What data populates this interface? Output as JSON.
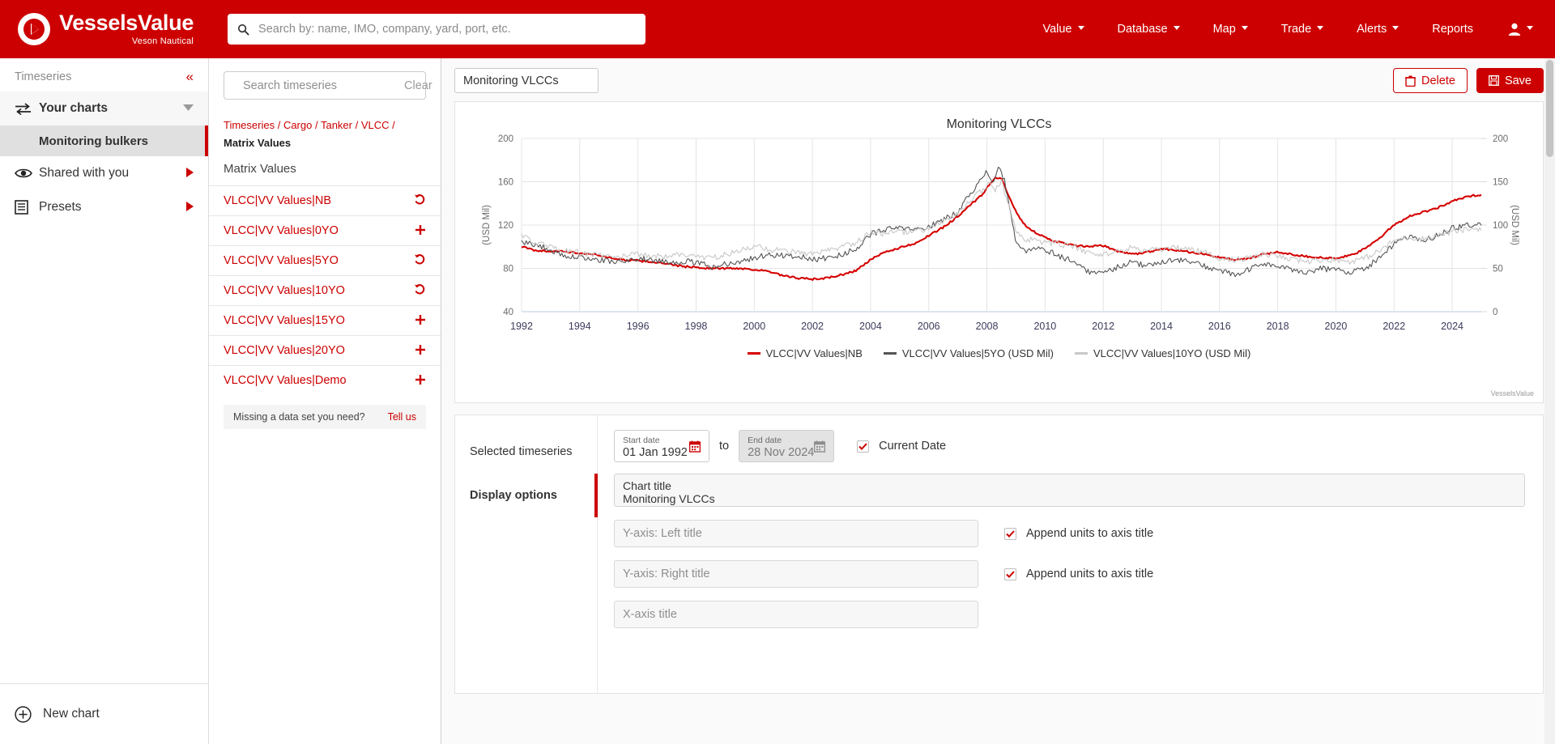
{
  "topbar": {
    "brand_name": "VesselsValue",
    "brand_sub": "Veson Nautical",
    "search_placeholder": "Search by: name, IMO, company, yard, port, etc.",
    "nav": [
      {
        "label": "Value",
        "caret": true
      },
      {
        "label": "Database",
        "caret": true
      },
      {
        "label": "Map",
        "caret": true
      },
      {
        "label": "Trade",
        "caret": true
      },
      {
        "label": "Alerts",
        "caret": true
      },
      {
        "label": "Reports",
        "caret": false
      }
    ],
    "user_icon": "user-icon"
  },
  "leftnav": {
    "title": "Timeseries",
    "collapse_icon": "collapse-left-icon",
    "your_charts": {
      "label": "Your charts",
      "icon": "transfer-icon"
    },
    "your_charts_children": [
      {
        "label": "Monitoring bulkers",
        "selected": true
      }
    ],
    "shared": {
      "label": "Shared with you",
      "icon": "eye-icon"
    },
    "presets": {
      "label": "Presets",
      "icon": "book-icon"
    },
    "new_chart": {
      "label": "New chart",
      "icon": "plus-circle-icon"
    }
  },
  "timeseries_panel": {
    "search_placeholder": "Search timeseries",
    "clear_label": "Clear",
    "breadcrumb": [
      "Timeseries",
      "Cargo",
      "Tanker",
      "VLCC"
    ],
    "breadcrumb_current": "Matrix Values",
    "group_label": "Matrix Values",
    "items": [
      {
        "label": "VLCC|VV Values|NB",
        "action": "undo"
      },
      {
        "label": "VLCC|VV Values|0YO",
        "action": "add"
      },
      {
        "label": "VLCC|VV Values|5YO",
        "action": "undo"
      },
      {
        "label": "VLCC|VV Values|10YO",
        "action": "undo"
      },
      {
        "label": "VLCC|VV Values|15YO",
        "action": "add"
      },
      {
        "label": "VLCC|VV Values|20YO",
        "action": "add"
      },
      {
        "label": "VLCC|VV Values|Demo",
        "action": "add"
      }
    ],
    "missing_text": "Missing a data set you need?",
    "missing_link": "Tell us"
  },
  "content_header": {
    "chart_name_value": "Monitoring VLCCs",
    "delete_label": "Delete",
    "save_label": "Save",
    "delete_icon": "trash-icon",
    "save_icon": "floppy-disk-icon"
  },
  "chart_data": {
    "type": "line",
    "title": "Monitoring VLCCs",
    "xlabel": "",
    "ylabel": "(USD Mil)",
    "ylabel_right": "(USD Mil)",
    "grid": true,
    "legend_position": "bottom",
    "xlim": [
      1992,
      2025
    ],
    "x_ticks": [
      1992,
      1994,
      1996,
      1998,
      2000,
      2002,
      2004,
      2006,
      2008,
      2010,
      2012,
      2014,
      2016,
      2018,
      2020,
      2022,
      2024
    ],
    "ylim_left": [
      40,
      200
    ],
    "y_ticks_left": [
      40,
      80,
      120,
      160,
      200
    ],
    "ylim_right": [
      0,
      200
    ],
    "y_ticks_right": [
      0,
      50,
      100,
      150,
      200
    ],
    "watermark": "VesselsValue",
    "series": [
      {
        "name": "VLCC|VV Values|NB",
        "color": "#d50000",
        "axis": "left",
        "x": [
          1992.0,
          1992.4,
          1992.8,
          1993.2,
          1993.6,
          1994.0,
          1994.5,
          1995.0,
          1995.5,
          1996.0,
          1996.5,
          1997.0,
          1997.5,
          1998.0,
          1998.5,
          1999.0,
          1999.5,
          2000.0,
          2000.5,
          2001.0,
          2001.5,
          2002.0,
          2002.5,
          2003.0,
          2003.5,
          2004.0,
          2004.5,
          2005.0,
          2005.5,
          2006.0,
          2006.5,
          2007.0,
          2007.3,
          2007.6,
          2007.9,
          2008.1,
          2008.3,
          2008.5,
          2008.7,
          2009.0,
          2009.3,
          2009.7,
          2010.0,
          2010.5,
          2011.0,
          2011.5,
          2012.0,
          2012.5,
          2013.0,
          2013.5,
          2014.0,
          2014.5,
          2015.0,
          2015.5,
          2016.0,
          2016.5,
          2017.0,
          2017.5,
          2018.0,
          2018.5,
          2019.0,
          2019.5,
          2020.0,
          2020.5,
          2021.0,
          2021.5,
          2022.0,
          2022.5,
          2023.0,
          2023.5,
          2024.0,
          2024.5,
          2024.9
        ],
        "y": [
          100,
          97,
          96,
          96,
          95,
          94,
          93,
          90,
          88,
          87,
          86,
          84,
          82,
          81,
          80,
          80,
          80,
          79,
          77,
          73,
          71,
          70,
          71,
          74,
          78,
          88,
          95,
          99,
          103,
          110,
          118,
          128,
          136,
          142,
          150,
          158,
          164,
          163,
          150,
          132,
          120,
          113,
          108,
          104,
          101,
          100,
          101,
          96,
          93,
          95,
          98,
          97,
          95,
          93,
          90,
          88,
          89,
          93,
          95,
          93,
          91,
          90,
          89,
          92,
          98,
          108,
          120,
          128,
          132,
          136,
          142,
          146,
          148
        ]
      },
      {
        "name": "VLCC|VV Values|5YO (USD Mil)",
        "color": "#555555",
        "axis": "right",
        "x": [
          1992.0,
          1992.5,
          1993.0,
          1993.5,
          1994.0,
          1994.5,
          1995.0,
          1995.5,
          1996.0,
          1996.5,
          1997.0,
          1997.5,
          1998.0,
          1998.5,
          1999.0,
          1999.5,
          2000.0,
          2000.5,
          2001.0,
          2001.5,
          2002.0,
          2002.5,
          2003.0,
          2003.5,
          2004.0,
          2004.5,
          2005.0,
          2005.5,
          2006.0,
          2006.5,
          2007.0,
          2007.3,
          2007.6,
          2007.8,
          2008.0,
          2008.2,
          2008.4,
          2008.6,
          2008.8,
          2009.0,
          2009.3,
          2009.7,
          2010.0,
          2010.5,
          2011.0,
          2011.5,
          2012.0,
          2012.5,
          2013.0,
          2013.5,
          2014.0,
          2014.5,
          2015.0,
          2015.5,
          2016.0,
          2016.5,
          2017.0,
          2017.5,
          2018.0,
          2018.5,
          2019.0,
          2019.5,
          2020.0,
          2020.5,
          2021.0,
          2021.5,
          2022.0,
          2022.5,
          2023.0,
          2023.5,
          2024.0,
          2024.5,
          2024.9
        ],
        "y": [
          81,
          77,
          72,
          62,
          63,
          61,
          58,
          57,
          62,
          60,
          57,
          58,
          57,
          52,
          55,
          58,
          62,
          66,
          65,
          64,
          60,
          62,
          66,
          72,
          90,
          94,
          97,
          94,
          98,
          106,
          115,
          132,
          143,
          152,
          162,
          148,
          168,
          152,
          115,
          78,
          70,
          74,
          72,
          64,
          58,
          46,
          44,
          52,
          58,
          52,
          58,
          60,
          58,
          52,
          48,
          42,
          48,
          56,
          52,
          48,
          46,
          50,
          48,
          46,
          50,
          62,
          78,
          86,
          82,
          88,
          96,
          100,
          101
        ]
      },
      {
        "name": "VLCC|VV Values|10YO (USD Mil)",
        "color": "#c8c8c8",
        "axis": "right",
        "x": [
          1992.0,
          1992.5,
          1993.0,
          1993.5,
          1994.0,
          1994.5,
          1995.0,
          1995.5,
          1996.0,
          1996.5,
          1997.0,
          1997.5,
          1998.0,
          1998.5,
          1999.0,
          1999.5,
          2000.0,
          2000.5,
          2001.0,
          2001.5,
          2002.0,
          2002.5,
          2003.0,
          2003.5,
          2004.0,
          2004.5,
          2005.0,
          2005.5,
          2006.0,
          2006.5,
          2007.0,
          2007.3,
          2007.6,
          2007.9,
          2008.1,
          2008.3,
          2008.5,
          2008.7,
          2009.0,
          2009.3,
          2009.7,
          2010.0,
          2010.5,
          2011.0,
          2011.5,
          2012.0,
          2012.5,
          2013.0,
          2013.5,
          2014.0,
          2014.5,
          2015.0,
          2015.5,
          2016.0,
          2016.5,
          2017.0,
          2017.5,
          2018.0,
          2018.5,
          2019.0,
          2019.5,
          2020.0,
          2020.5,
          2021.0,
          2021.5,
          2022.0,
          2022.5,
          2023.0,
          2023.5,
          2024.0,
          2024.5,
          2024.9
        ],
        "y": [
          87,
          80,
          74,
          70,
          68,
          66,
          64,
          64,
          66,
          65,
          64,
          66,
          64,
          62,
          66,
          70,
          76,
          72,
          70,
          68,
          66,
          70,
          74,
          80,
          92,
          90,
          92,
          92,
          96,
          104,
          112,
          124,
          134,
          142,
          150,
          140,
          152,
          128,
          92,
          84,
          82,
          80,
          78,
          74,
          68,
          66,
          70,
          74,
          70,
          72,
          74,
          72,
          68,
          62,
          60,
          62,
          66,
          64,
          60,
          58,
          60,
          60,
          58,
          62,
          70,
          82,
          86,
          84,
          88,
          92,
          95,
          96
        ]
      }
    ]
  },
  "options": {
    "tabs": [
      {
        "label": "Selected timeseries",
        "active": false
      },
      {
        "label": "Display options",
        "active": true
      }
    ],
    "start_date": {
      "label": "Start date",
      "value": "01 Jan 1992"
    },
    "end_date": {
      "label": "End date",
      "value": "28 Nov 2024"
    },
    "to_label": "to",
    "current_date": {
      "label": "Current Date",
      "checked": true
    },
    "chart_title": {
      "label": "Chart title",
      "value": "Monitoring VLCCs"
    },
    "y_left": {
      "placeholder": "Y-axis: Left title",
      "value": "",
      "append_units_label": "Append units to axis title",
      "append_units_checked": true
    },
    "y_right": {
      "placeholder": "Y-axis: Right title",
      "value": "",
      "append_units_label": "Append units to axis title",
      "append_units_checked": true
    },
    "x_axis": {
      "placeholder": "X-axis title",
      "value": ""
    }
  },
  "colors": {
    "brand_red": "#cc0000",
    "series_nb": "#d50000",
    "series_5yo": "#555555",
    "series_10yo": "#c8c8c8"
  }
}
